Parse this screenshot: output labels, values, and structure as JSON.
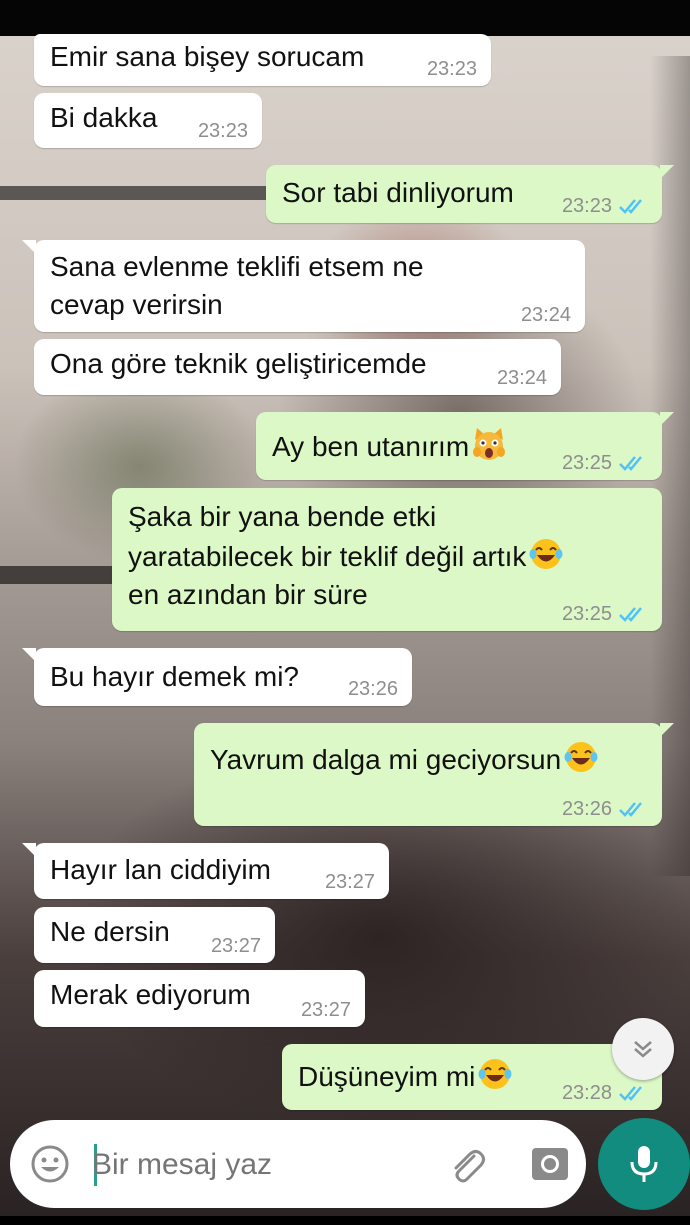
{
  "messages": [
    {
      "side": "in",
      "text": "Emir sana bişey sorucam",
      "time": "23:23"
    },
    {
      "side": "in",
      "text": "Bi dakka",
      "time": "23:23"
    },
    {
      "side": "out",
      "text": "Sor tabi dinliyorum",
      "time": "23:23"
    },
    {
      "side": "in",
      "text": "Sana evlenme teklifi etsem ne\ncevap verirsin",
      "time": "23:24"
    },
    {
      "side": "in",
      "text": "Ona göre teknik geliştiricemde",
      "time": "23:24"
    },
    {
      "side": "out",
      "text": "Ay ben utanırım",
      "time": "23:25",
      "emoji": "scream-cat"
    },
    {
      "side": "out",
      "text_lines": [
        "Şaka bir yana bende etki",
        "yaratabilecek bir teklif değil artık",
        "en azından bir süre"
      ],
      "time": "23:25",
      "emoji": "tears-of-joy"
    },
    {
      "side": "in",
      "text": "Bu hayır demek mi?",
      "time": "23:26"
    },
    {
      "side": "out",
      "text": "Yavrum dalga mi geciyorsun",
      "time": "23:26",
      "emoji": "tears-of-joy"
    },
    {
      "side": "in",
      "text": "Hayır lan ciddiyim",
      "time": "23:27"
    },
    {
      "side": "in",
      "text": "Ne dersin",
      "time": "23:27"
    },
    {
      "side": "in",
      "text": "Merak ediyorum",
      "time": "23:27"
    },
    {
      "side": "out",
      "text": "Düşüneyim mi",
      "time": "23:28",
      "emoji": "tears-of-joy"
    }
  ],
  "composer": {
    "placeholder": "Bir mesaj yaz",
    "icons": [
      "smiley-icon",
      "paperclip-icon",
      "camera-icon",
      "microphone-icon"
    ]
  },
  "colors": {
    "incoming_bubble": "#ffffff",
    "outgoing_bubble": "#dcf8c6",
    "read_ticks": "#4fc3f7",
    "mic_button": "#128c7e"
  }
}
